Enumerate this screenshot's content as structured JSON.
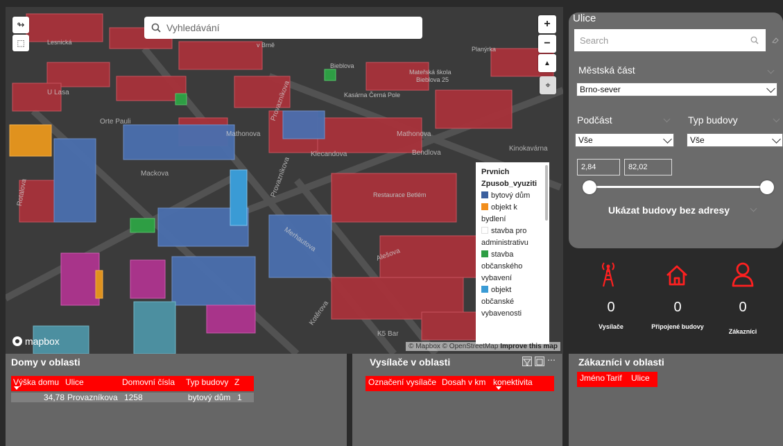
{
  "map": {
    "search_placeholder": "Vyhledávání",
    "zoom_in": "+",
    "zoom_out": "−",
    "labels": {
      "planirka": "Planýrka",
      "bieblova": "Bieblova",
      "materska": "Mateřská škola",
      "materska2": "Bieblova 25",
      "kasarna": "Kasárna Černá Pole",
      "ulasa": "U Lasa",
      "orte": "Orte Pauli",
      "mathonova": "Mathonova",
      "provaznikova": "Provazníkova",
      "kleandova": "Klecandova",
      "bendlova": "Bendlova",
      "kinokavarna": "Kinokavárna",
      "restaurace": "Restaurace Betlém",
      "merhautova": "Merhautova",
      "aleslova": "Alešova",
      "koterova": "Kotěrova",
      "k5bar": "K5 Bar",
      "rotalova": "Rotalova",
      "lesnicka": "Lesnická",
      "vbrne": "v Brně",
      "mackova": "Mackova"
    },
    "legend": {
      "title1": "Prvnich",
      "title2": "Zpusob_vyuziti",
      "items": [
        {
          "label1": "bytový dům",
          "label2": "",
          "color": "#3a5f9e"
        },
        {
          "label1": "objekt k",
          "label2": "bydlení",
          "color": "#f28e1c"
        },
        {
          "label1": "stavba pro",
          "label2": "administrativu",
          "color": "#ffffff"
        },
        {
          "label1": "stavba",
          "label2": "občanského",
          "label3": "vybavení",
          "color": "#2e9e44"
        },
        {
          "label1": "objekt",
          "label2": "občanské",
          "label3": "vybavenosti",
          "color": "#3a9bd5"
        }
      ]
    },
    "logo_text": "mapbox",
    "attribution": "© Mapbox © OpenStreetMap",
    "improve": "Improve this map"
  },
  "ulice": {
    "title": "Ulice",
    "search_placeholder": "Search",
    "mestska_cast_label": "Městská část",
    "mestska_cast_value": "Brno-sever",
    "podcast_label": "Podčást",
    "podcast_value": "Vše",
    "typ_budovy_label": "Typ budovy",
    "typ_budovy_value": "Vše",
    "range_min": "2,84",
    "range_max": "82,02",
    "range_low_fraction": 0.0,
    "range_high_fraction": 1.0,
    "show_no_address": "Ukázat budovy bez adresy"
  },
  "stats": [
    {
      "icon": "antenna-icon",
      "value": "0",
      "label": "Vysílače"
    },
    {
      "icon": "home-icon",
      "value": "0",
      "label": "Připojené budovy"
    },
    {
      "icon": "user-icon",
      "value": "0",
      "label": "Zákazníci"
    }
  ],
  "domy": {
    "title": "Domy v oblasti",
    "columns": [
      "Výška domu",
      "Ulice",
      "Domovní čísla",
      "Typ budovy",
      "Z"
    ],
    "rows": [
      [
        "34,78",
        "Provazníkova",
        "1258",
        "bytový dům",
        "1"
      ]
    ]
  },
  "vysilace": {
    "title": "Vysílače v oblasti",
    "columns": [
      "Označení vysílače",
      "Dosah v km",
      "konektivita"
    ]
  },
  "zakaznici": {
    "title": "Zákazníci v oblasti",
    "columns": [
      "Jméno",
      "Tarif",
      "Ulice"
    ]
  },
  "colors": {
    "accent": "#ff0000",
    "panel": "#6b6b6b",
    "background": "#2a2a2a",
    "building_red": "#b0343a",
    "building_blue": "#4a6fb0"
  }
}
